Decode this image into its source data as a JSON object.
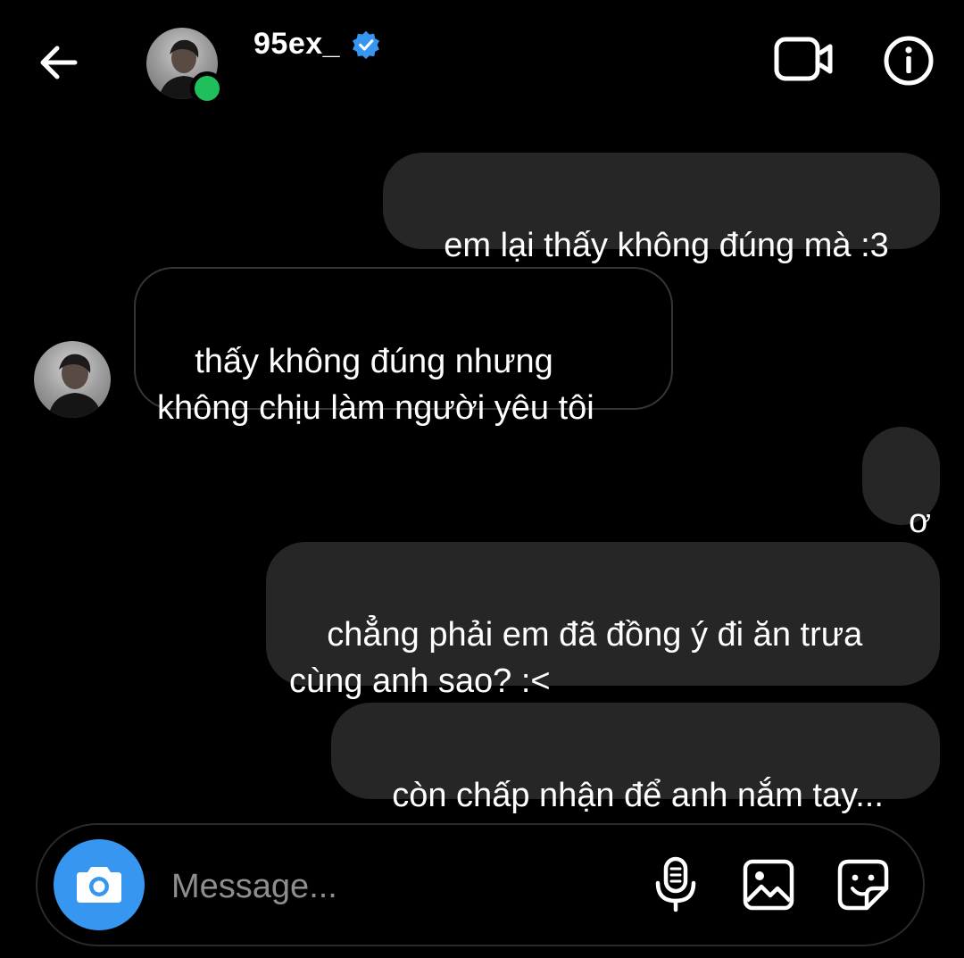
{
  "header": {
    "username": "95ex_",
    "verified": true,
    "online": true
  },
  "messages": [
    {
      "sender": "me",
      "text": "em lại thấy không đúng mà :3"
    },
    {
      "sender": "them",
      "text": "thấy không đúng nhưng\nkhông chịu làm người yêu tôi"
    },
    {
      "sender": "me",
      "text": "ơ"
    },
    {
      "sender": "me",
      "text": "chẳng phải em đã đồng ý đi ăn trưa\ncùng anh sao? :<"
    },
    {
      "sender": "me",
      "text": "còn chấp nhận để anh nắm tay..."
    }
  ],
  "composer": {
    "placeholder": "Message..."
  },
  "icons": {
    "back": "back-arrow-icon",
    "verified": "verified-badge-icon",
    "video": "video-camera-icon",
    "info": "info-icon",
    "camera": "camera-icon",
    "mic": "microphone-icon",
    "gallery": "image-gallery-icon",
    "sticker": "sticker-icon"
  },
  "colors": {
    "background": "#000000",
    "sent_bubble": "#262626",
    "received_border": "#363636",
    "accent_blue": "#3797f0",
    "online_green": "#1fc05b",
    "placeholder": "#8e8e8e"
  }
}
